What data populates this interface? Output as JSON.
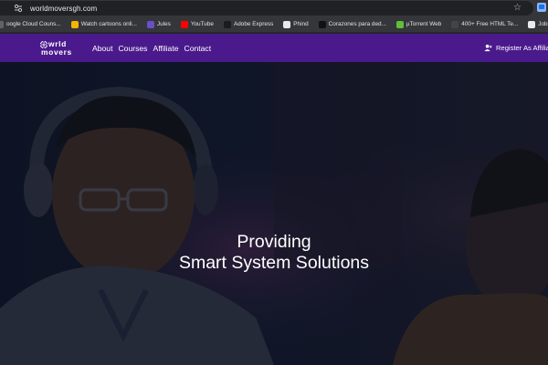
{
  "browser": {
    "url": "worldmoversgh.com",
    "bookmarks": [
      {
        "label": "oogle Cloud Couns...",
        "icon": "google-cloud-icon",
        "color": "#5f6368"
      },
      {
        "label": "Watch cartoons onli...",
        "icon": "cartoons-icon",
        "color": "#f4b400"
      },
      {
        "label": "Jules",
        "icon": "jules-icon",
        "color": "#6a4fc7"
      },
      {
        "label": "YouTube",
        "icon": "youtube-icon",
        "color": "#ff0000"
      },
      {
        "label": "Adobe Express",
        "icon": "adobe-icon",
        "color": "#1b1b1b"
      },
      {
        "label": "Phind",
        "icon": "phind-icon",
        "color": "#e8eaed"
      },
      {
        "label": "Corazones para ded...",
        "icon": "heart-icon",
        "color": "#111111"
      },
      {
        "label": "µTorrent Web",
        "icon": "utorrent-icon",
        "color": "#5fbf3a"
      },
      {
        "label": "400+ Free HTML Te...",
        "icon": "html-template-icon",
        "color": "#444444"
      },
      {
        "label": "Jobsinghana.com - J...",
        "icon": "jobs-icon",
        "color": "#e8eaed"
      }
    ]
  },
  "site": {
    "logo_line1": "wrld",
    "logo_line2": "movers",
    "nav": [
      "About",
      "Courses",
      "Affiliate",
      "Contact"
    ],
    "register_label": "Register As Affiliate",
    "nav_color": "#4a1a8c"
  },
  "hero": {
    "line1": "Providing",
    "line2": "Smart System Solutions"
  }
}
